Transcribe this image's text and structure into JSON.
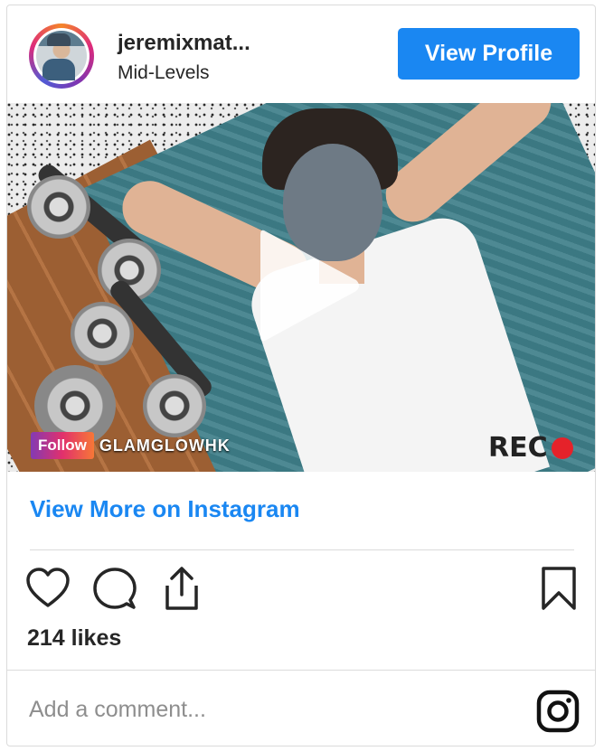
{
  "header": {
    "username": "jeremixmat...",
    "location": "Mid-Levels",
    "view_profile_label": "View Profile"
  },
  "media": {
    "follow_badge": "Follow",
    "follow_handle": "GLAMGLOWHK",
    "rec_label": "REC",
    "play_icon": "play-icon"
  },
  "view_more_label": "View More on Instagram",
  "actions": {
    "icons": [
      "heart-icon",
      "comment-icon",
      "share-icon",
      "bookmark-icon"
    ]
  },
  "likes_text": "214 likes",
  "comment": {
    "placeholder": "Add a comment...",
    "logo_icon": "instagram-icon"
  },
  "colors": {
    "accent": "#1a87f2",
    "text": "#262626",
    "muted": "#8e8e8e",
    "rec_dot": "#e5222a"
  }
}
